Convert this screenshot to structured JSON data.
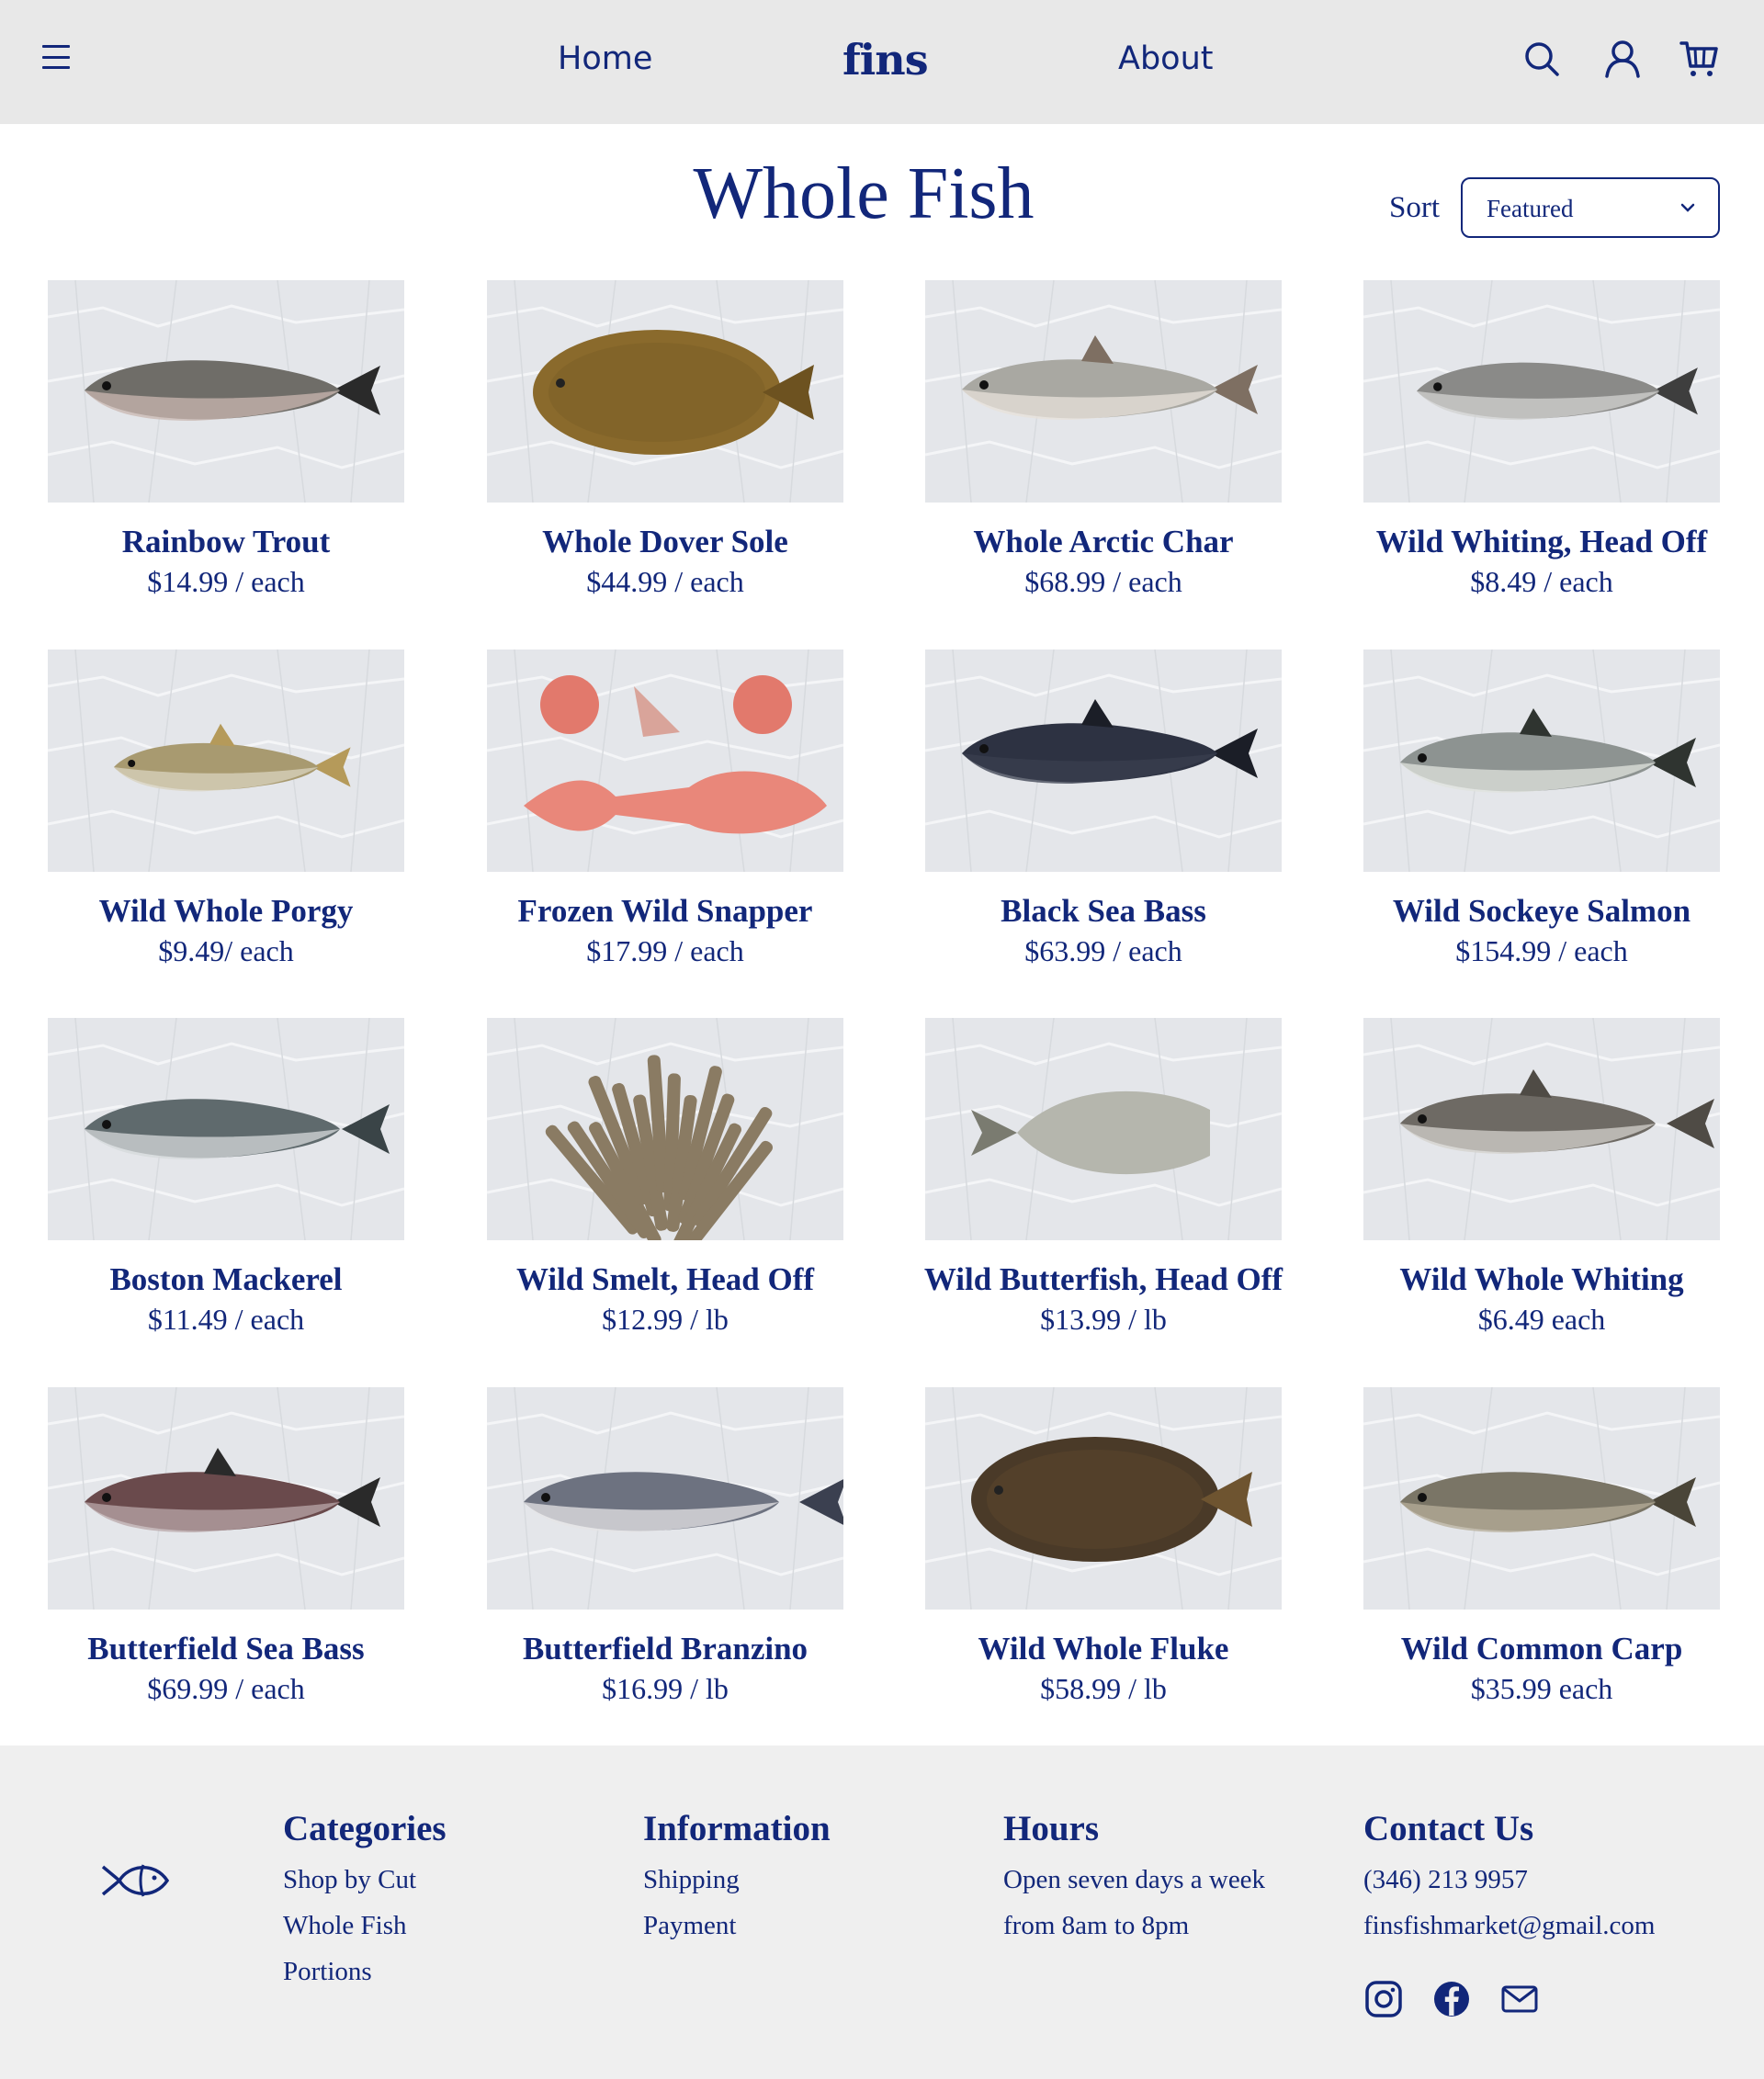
{
  "nav": {
    "links": [
      "Home",
      "About"
    ],
    "logo": "fins",
    "icons": [
      "menu-icon",
      "search-icon",
      "account-icon",
      "cart-icon"
    ]
  },
  "header": {
    "title": "Whole Fish",
    "sort_label": "Sort",
    "sort_value": "Featured"
  },
  "products": [
    {
      "name": "Rainbow Trout",
      "price": "$14.99 / each"
    },
    {
      "name": "Whole Dover Sole",
      "price": "$44.99 / each"
    },
    {
      "name": "Whole Arctic Char",
      "price": "$68.99 / each"
    },
    {
      "name": "Wild Whiting, Head Off",
      "price": "$8.49 / each"
    },
    {
      "name": "Wild Whole Porgy",
      "price": "$9.49/ each"
    },
    {
      "name": "Frozen Wild Snapper",
      "price": "$17.99 / each"
    },
    {
      "name": "Black Sea Bass",
      "price": "$63.99 / each"
    },
    {
      "name": "Wild Sockeye Salmon",
      "price": "$154.99 / each"
    },
    {
      "name": "Boston Mackerel",
      "price": "$11.49 / each"
    },
    {
      "name": "Wild Smelt, Head Off",
      "price": "$12.99 / lb"
    },
    {
      "name": "Wild Butterfish, Head Off",
      "price": "$13.99 / lb"
    },
    {
      "name": "Wild Whole Whiting",
      "price": "$6.49 each"
    },
    {
      "name": "Butterfield Sea Bass",
      "price": "$69.99 / each"
    },
    {
      "name": "Butterfield Branzino",
      "price": "$16.99 / lb"
    },
    {
      "name": "Wild Whole Fluke",
      "price": "$58.99 / lb"
    },
    {
      "name": "Wild Common Carp",
      "price": "$35.99 each"
    }
  ],
  "footer": {
    "categories": {
      "title": "Categories",
      "items": [
        "Shop by Cut",
        "Whole Fish",
        "Portions"
      ]
    },
    "information": {
      "title": "Information",
      "items": [
        "Shipping",
        "Payment"
      ]
    },
    "hours": {
      "title": "Hours",
      "lines": [
        "Open seven days a week",
        "from 8am to 8pm"
      ]
    },
    "contact": {
      "title": "Contact Us",
      "phone": "(346) 213 9957",
      "email": "finsfishmarket@gmail.com"
    },
    "social": [
      "instagram-icon",
      "facebook-icon",
      "mail-icon"
    ]
  },
  "colors": {
    "brand": "#12277a",
    "nav_bg": "#e8e8e8",
    "footer_bg": "#efefef",
    "ice": "#e4e6ea"
  }
}
